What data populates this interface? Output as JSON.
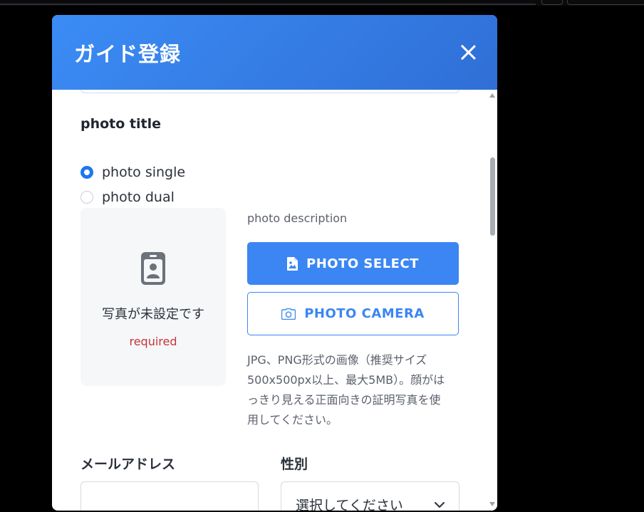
{
  "modal": {
    "title": "ガイド登録",
    "close_icon": "close-icon"
  },
  "photo": {
    "section_label": "photo title",
    "options": [
      {
        "label": "photo single",
        "checked": true
      },
      {
        "label": "photo dual",
        "checked": false
      }
    ],
    "placeholder_icon": "id-badge-icon",
    "status": "写真が未設定です",
    "required": "required",
    "description": "photo description",
    "select_button": {
      "label": "PHOTO SELECT",
      "icon": "image-file-icon"
    },
    "camera_button": {
      "label": "PHOTO CAMERA",
      "icon": "camera-icon"
    },
    "help_lines": [
      "JPG、PNG形式の画像（推奨サイズ",
      "500x500px以上、最大5MB）。顔がは",
      "っきり見える正面向きの証明写真を使",
      "用してください。"
    ]
  },
  "form": {
    "email_label": "メールアドレス",
    "email_value": "",
    "gender_label": "性別",
    "gender_value": "選択してください"
  },
  "colors": {
    "header_gradient_start": "#3b8cf5",
    "header_gradient_end": "#2f6fd6",
    "primary": "#3b86f3",
    "required": "#c9323c",
    "radio_checked": "#1d76f2"
  }
}
